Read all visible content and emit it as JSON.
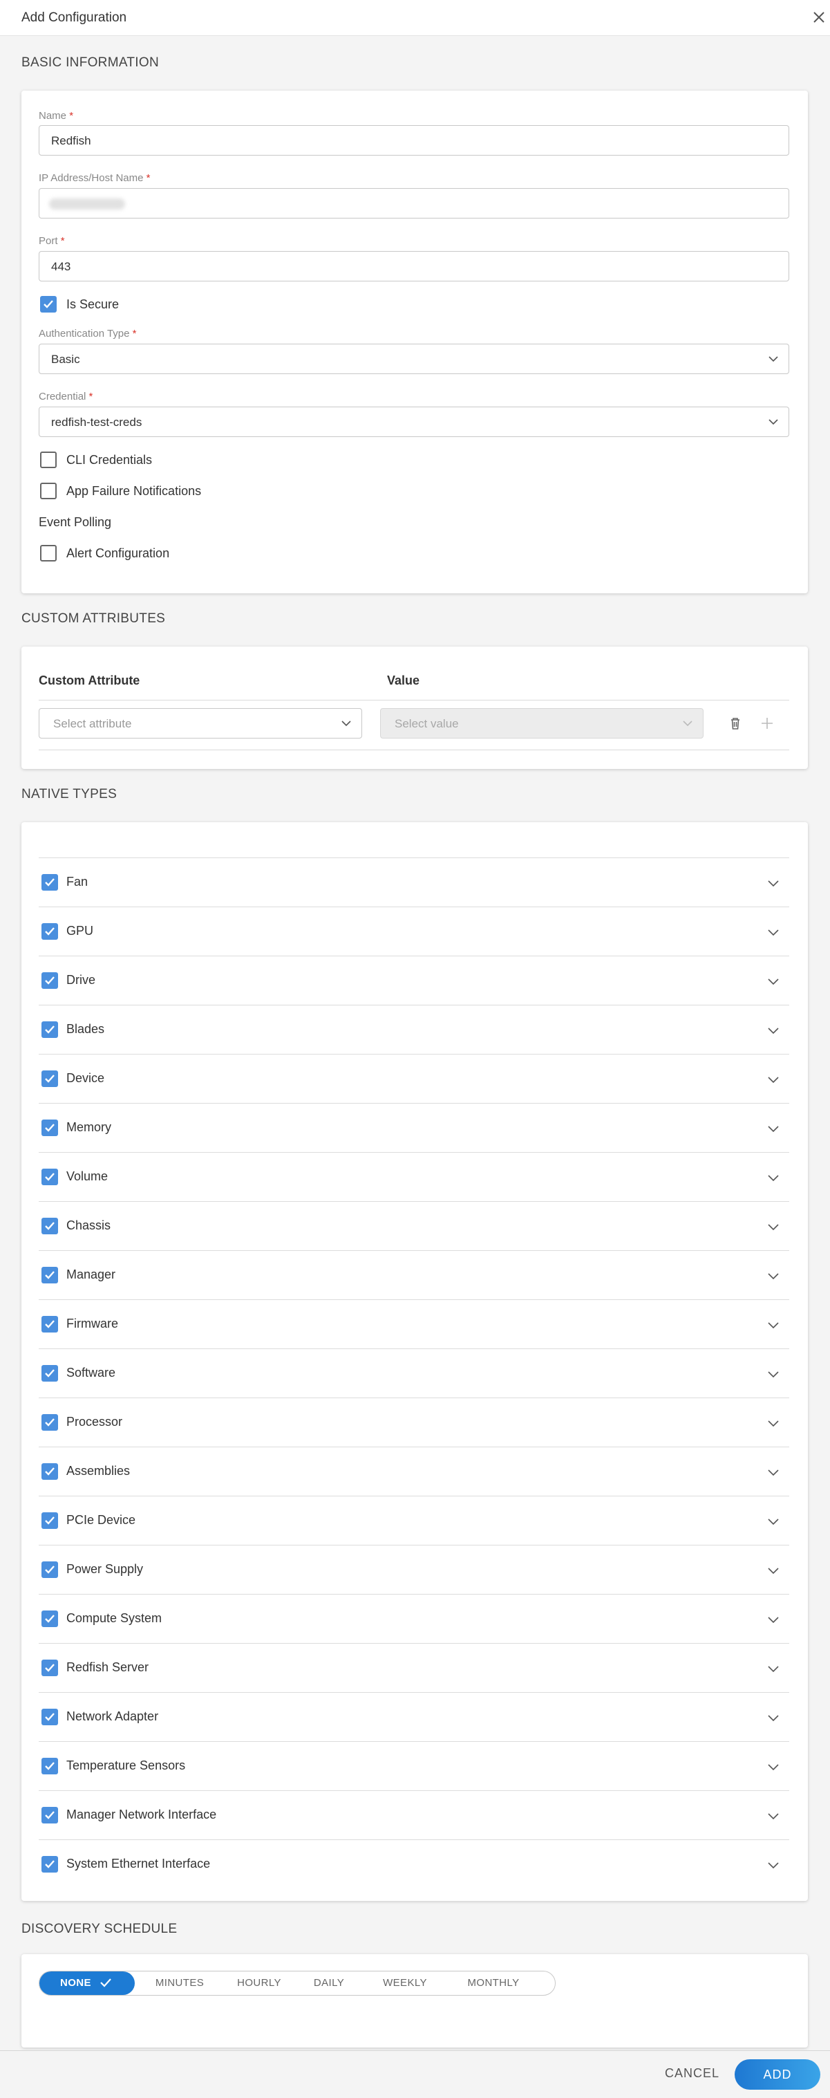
{
  "header": {
    "title": "Add Configuration"
  },
  "sections": {
    "basic": "BASIC INFORMATION",
    "custom": "CUSTOM ATTRIBUTES",
    "native": "NATIVE TYPES",
    "schedule": "DISCOVERY SCHEDULE"
  },
  "basic": {
    "name_label": "Name",
    "name_value": "Redfish",
    "ip_label": "IP Address/Host Name",
    "port_label": "Port",
    "port_value": "443",
    "is_secure_label": "Is Secure",
    "is_secure_checked": true,
    "auth_label": "Authentication Type",
    "auth_value": "Basic",
    "credential_label": "Credential",
    "credential_value": "redfish-test-creds",
    "cli_label": "CLI Credentials",
    "app_failure_label": "App Failure Notifications",
    "event_polling_label": "Event Polling",
    "alert_config_label": "Alert Configuration",
    "required_mark": "*"
  },
  "custom_attributes": {
    "col_attribute": "Custom Attribute",
    "col_value": "Value",
    "attribute_placeholder": "Select attribute",
    "value_placeholder": "Select value"
  },
  "native_types": [
    {
      "label": "Fan",
      "checked": true
    },
    {
      "label": "GPU",
      "checked": true
    },
    {
      "label": "Drive",
      "checked": true
    },
    {
      "label": "Blades",
      "checked": true
    },
    {
      "label": "Device",
      "checked": true
    },
    {
      "label": "Memory",
      "checked": true
    },
    {
      "label": "Volume",
      "checked": true
    },
    {
      "label": "Chassis",
      "checked": true
    },
    {
      "label": "Manager",
      "checked": true
    },
    {
      "label": "Firmware",
      "checked": true
    },
    {
      "label": "Software",
      "checked": true
    },
    {
      "label": "Processor",
      "checked": true
    },
    {
      "label": "Assemblies",
      "checked": true
    },
    {
      "label": "PCIe Device",
      "checked": true
    },
    {
      "label": "Power Supply",
      "checked": true
    },
    {
      "label": "Compute System",
      "checked": true
    },
    {
      "label": "Redfish Server",
      "checked": true
    },
    {
      "label": "Network Adapter",
      "checked": true
    },
    {
      "label": "Temperature Sensors",
      "checked": true
    },
    {
      "label": "Manager Network Interface",
      "checked": true
    },
    {
      "label": "System Ethernet Interface",
      "checked": true
    }
  ],
  "schedule": {
    "options": [
      "NONE",
      "MINUTES",
      "HOURLY",
      "DAILY",
      "WEEKLY",
      "MONTHLY"
    ],
    "selected": "NONE"
  },
  "footer": {
    "cancel_label": "CANCEL",
    "add_label": "ADD"
  },
  "colors": {
    "accent": "#1d7bd4",
    "checkbox": "#4a8fde",
    "required": "#d9342b"
  },
  "icons": {
    "close": "close-icon",
    "chevron": "chevron-down-icon",
    "check": "check-icon",
    "delete": "trash-icon",
    "add": "plus-icon"
  }
}
